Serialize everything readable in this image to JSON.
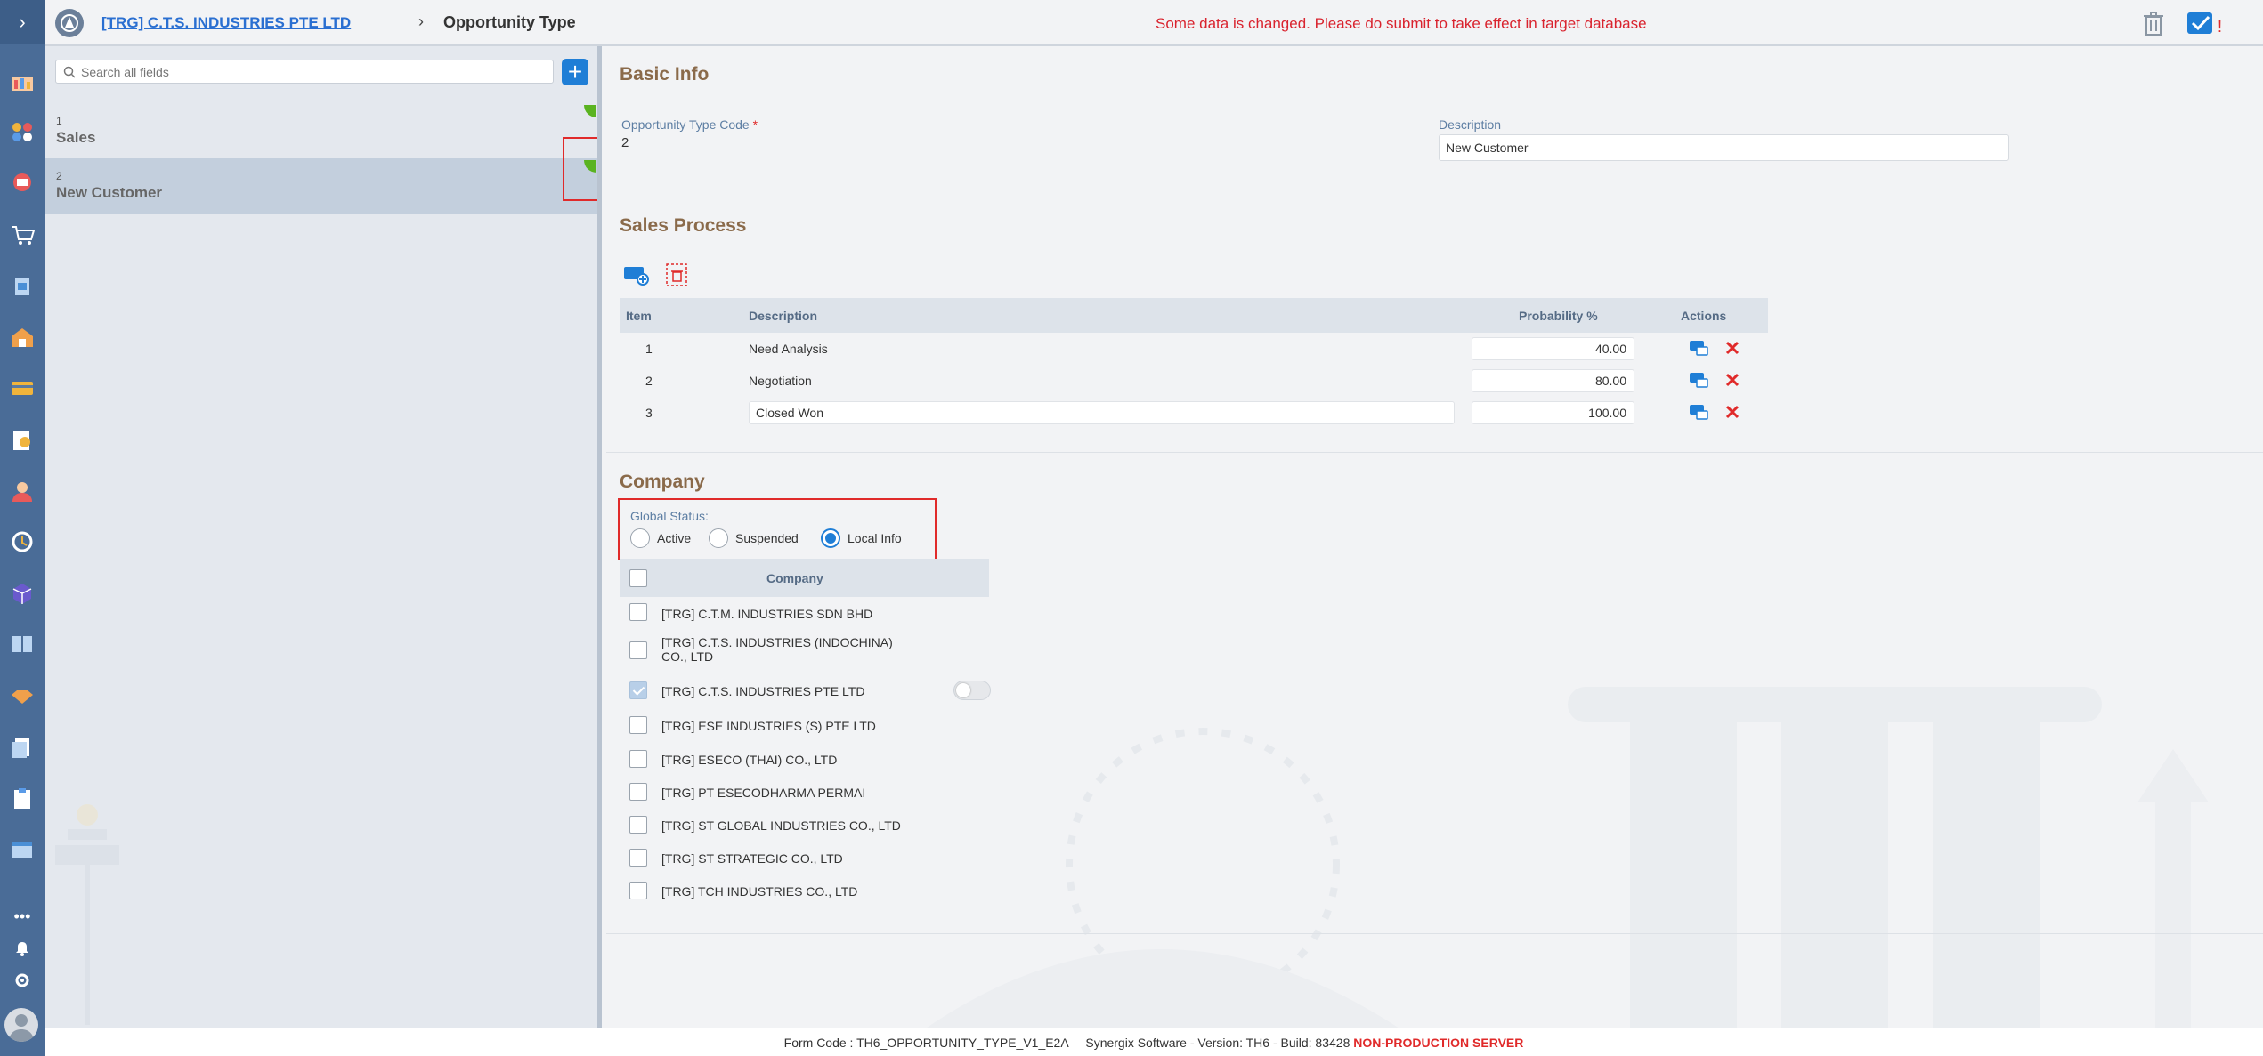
{
  "header": {
    "company": "[TRG] C.T.S. INDUSTRIES PTE LTD",
    "breadcrumb_sep": "›",
    "page_title": "Opportunity Type",
    "warning": "Some data is changed. Please do submit to take effect in target database",
    "submit_flag": "!"
  },
  "sidebar": {
    "search_placeholder": "Search all fields",
    "items": [
      {
        "code": "1",
        "name": "Sales"
      },
      {
        "code": "2",
        "name": "New Customer"
      }
    ]
  },
  "basic_info": {
    "title": "Basic Info",
    "code_label": "Opportunity Type Code",
    "required_mark": "*",
    "code_value": "2",
    "desc_label": "Description",
    "desc_value": "New Customer"
  },
  "sales_process": {
    "title": "Sales Process",
    "columns": {
      "item": "Item",
      "description": "Description",
      "probability": "Probability %",
      "actions": "Actions"
    },
    "rows": [
      {
        "item": "1",
        "description": "Need Analysis",
        "probability": "40.00"
      },
      {
        "item": "2",
        "description": "Negotiation",
        "probability": "80.00"
      },
      {
        "item": "3",
        "description": "Closed Won",
        "probability": "100.00"
      }
    ]
  },
  "company": {
    "title": "Company",
    "global_status_label": "Global Status:",
    "statuses": [
      "Active",
      "Suspended",
      "Local Info"
    ],
    "selected_status": "Local Info",
    "column": "Company",
    "rows": [
      {
        "name": "[TRG] C.T.M. INDUSTRIES SDN BHD",
        "checked": false
      },
      {
        "name": "[TRG] C.T.S. INDUSTRIES (INDOCHINA) CO., LTD",
        "checked": false
      },
      {
        "name": "[TRG] C.T.S. INDUSTRIES PTE LTD",
        "checked": true
      },
      {
        "name": "[TRG] ESE INDUSTRIES (S) PTE LTD",
        "checked": false
      },
      {
        "name": "[TRG] ESECO (THAI) CO., LTD",
        "checked": false
      },
      {
        "name": "[TRG] PT ESECODHARMA PERMAI",
        "checked": false
      },
      {
        "name": "[TRG] ST GLOBAL INDUSTRIES CO., LTD",
        "checked": false
      },
      {
        "name": "[TRG] ST STRATEGIC CO., LTD",
        "checked": false
      },
      {
        "name": "[TRG] TCH INDUSTRIES CO., LTD",
        "checked": false
      }
    ]
  },
  "footer": {
    "text": "Form Code : TH6_OPPORTUNITY_TYPE_V1_E2A     Synergix Software - Version: TH6 - Build: 83428",
    "server": "NON-PRODUCTION SERVER"
  },
  "colors": {
    "accent": "#1f7ed6",
    "rail": "#4a6c97",
    "warning": "#d9232e",
    "section_title": "#8a6a4a"
  }
}
